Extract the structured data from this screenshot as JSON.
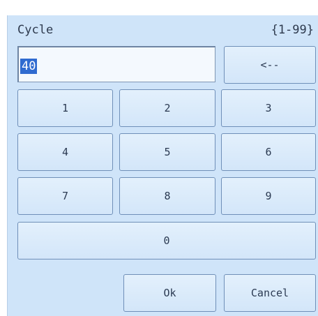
{
  "dialog": {
    "title": "Cycle",
    "range": "{1-99}",
    "entry_value": "40"
  },
  "keypad": {
    "backspace": "<--",
    "keys": [
      "1",
      "2",
      "3",
      "4",
      "5",
      "6",
      "7",
      "8",
      "9",
      "0"
    ]
  },
  "actions": {
    "ok": "Ok",
    "cancel": "Cancel"
  }
}
